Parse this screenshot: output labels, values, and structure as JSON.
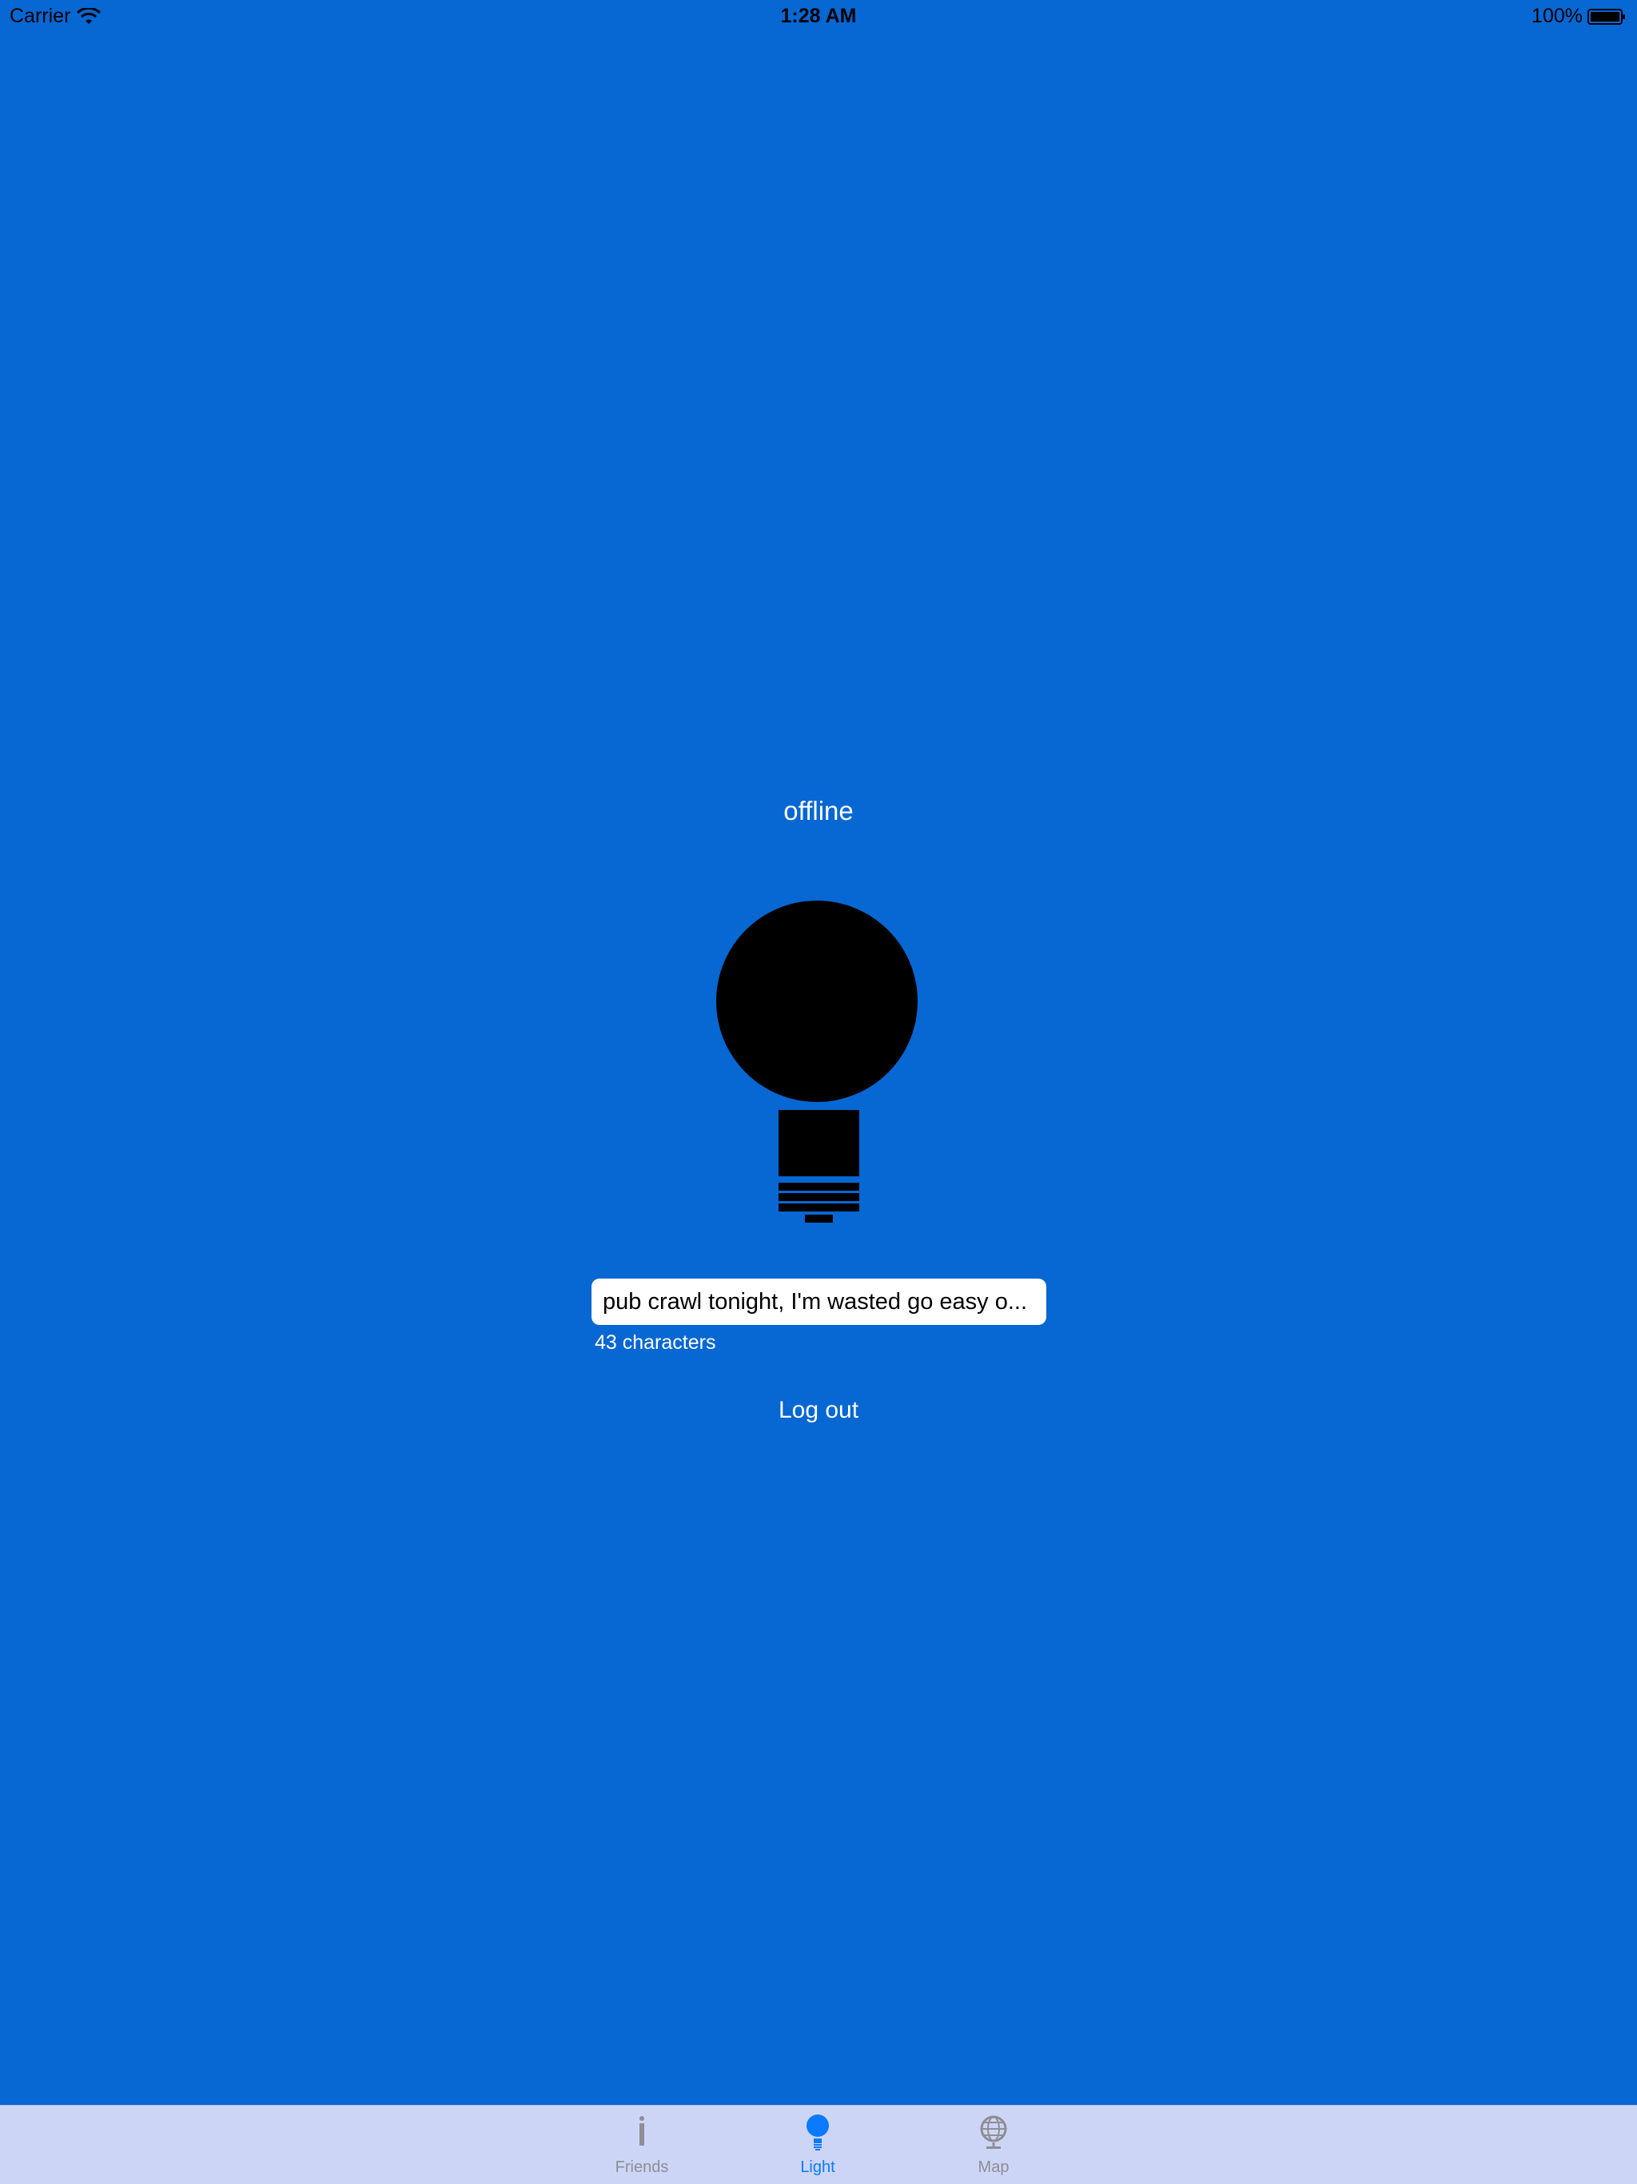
{
  "status_bar": {
    "carrier": "Carrier",
    "time": "1:28 AM",
    "battery": "100%"
  },
  "main": {
    "status_label": "offline",
    "message_value": "pub crawl tonight, I'm wasted go easy o...",
    "char_count": "43 characters",
    "logout_label": "Log out",
    "bulb_icon": "lightbulb-icon"
  },
  "tab_bar": {
    "tabs": [
      {
        "label": "Friends",
        "icon": "friends-icon",
        "active": false
      },
      {
        "label": "Light",
        "icon": "lightbulb-icon",
        "active": true
      },
      {
        "label": "Map",
        "icon": "globe-icon",
        "active": false
      }
    ]
  },
  "colors": {
    "background": "#0767d3",
    "tab_bar_background": "#cdd5f7",
    "tab_active": "#0a7aff",
    "tab_inactive": "#8e8e93",
    "bulb": "#000000"
  }
}
